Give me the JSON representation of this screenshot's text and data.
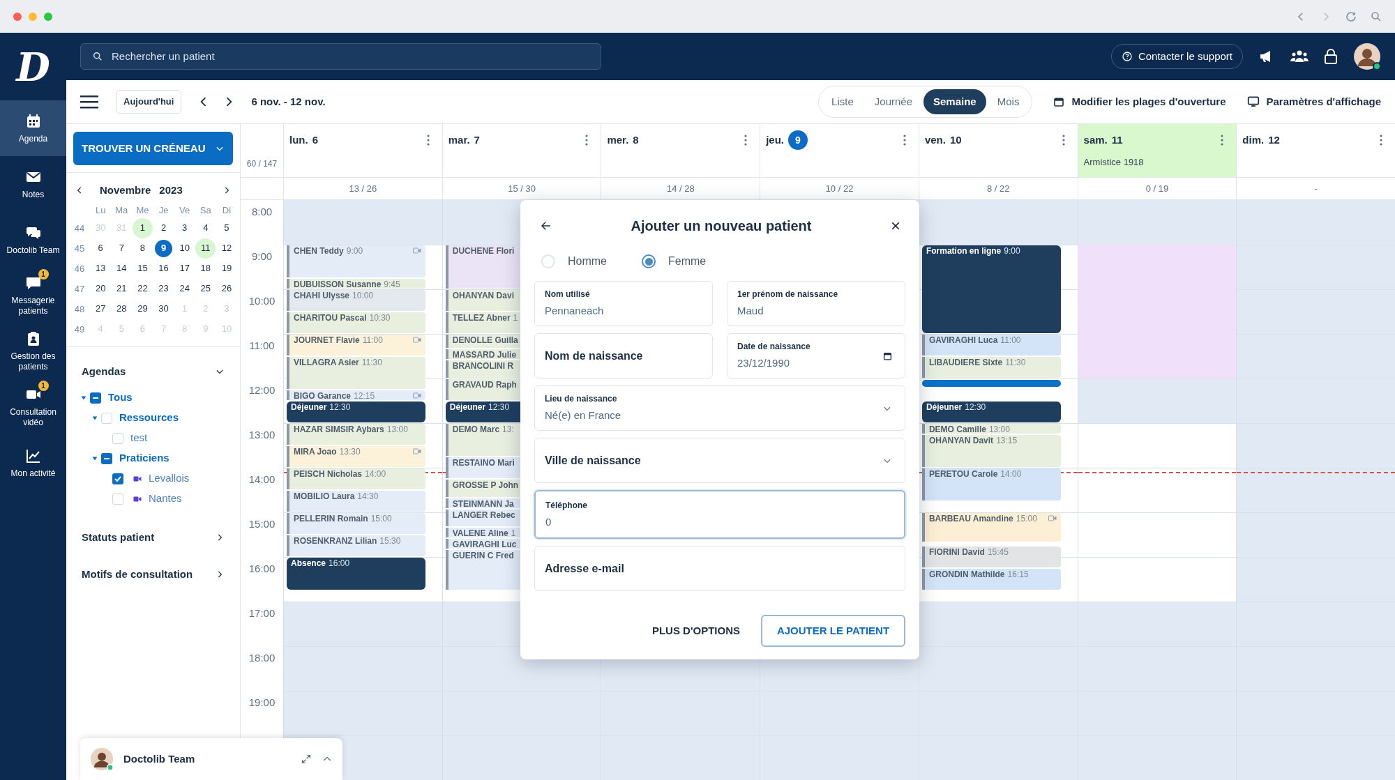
{
  "nav": {
    "logo": "D",
    "items": [
      {
        "label": "Agenda",
        "selected": true
      },
      {
        "label": "Notes",
        "selected": false
      },
      {
        "label": "Doctolib Team",
        "selected": false
      },
      {
        "label": "Messagerie patients",
        "selected": false,
        "badge": "1"
      },
      {
        "label": "Gestion des patients",
        "selected": false
      },
      {
        "label": "Consultation vidéo",
        "selected": false,
        "badge": "1"
      },
      {
        "label": "Mon activité",
        "selected": false
      }
    ]
  },
  "search": {
    "placeholder": "Rechercher un patient"
  },
  "support_button": "Contacter le support",
  "toolbar": {
    "today": "Aujourd'hui",
    "range": "6 nov. - 12 nov.",
    "views": [
      {
        "label": "Liste",
        "selected": false
      },
      {
        "label": "Journée",
        "selected": false
      },
      {
        "label": "Semaine",
        "selected": true
      },
      {
        "label": "Mois",
        "selected": false
      }
    ],
    "actions": [
      "Modifier les plages d'ouverture",
      "Paramètres d'affichage"
    ]
  },
  "find_slot": "TROUVER UN CRÉNEAU",
  "mini_calendar": {
    "month": "Novembre",
    "year": "2023",
    "weekdays": [
      "Lu",
      "Ma",
      "Me",
      "Je",
      "Ve",
      "Sa",
      "Di"
    ],
    "weeks": [
      {
        "number": "44",
        "days": [
          {
            "label": "30",
            "outside": true,
            "marked": false,
            "selected": false
          },
          {
            "label": "31",
            "outside": true,
            "marked": false,
            "selected": false
          },
          {
            "label": "1",
            "outside": false,
            "marked": true,
            "selected": false
          },
          {
            "label": "2",
            "outside": false,
            "marked": false,
            "selected": false
          },
          {
            "label": "3",
            "outside": false,
            "marked": false,
            "selected": false
          },
          {
            "label": "4",
            "outside": false,
            "marked": false,
            "selected": false
          },
          {
            "label": "5",
            "outside": false,
            "marked": false,
            "selected": false
          }
        ]
      },
      {
        "number": "45",
        "days": [
          {
            "label": "6",
            "outside": false,
            "marked": false,
            "selected": false
          },
          {
            "label": "7",
            "outside": false,
            "marked": false,
            "selected": false
          },
          {
            "label": "8",
            "outside": false,
            "marked": false,
            "selected": false
          },
          {
            "label": "9",
            "outside": false,
            "marked": false,
            "selected": true
          },
          {
            "label": "10",
            "outside": false,
            "marked": false,
            "selected": false
          },
          {
            "label": "11",
            "outside": false,
            "marked": true,
            "selected": false
          },
          {
            "label": "12",
            "outside": false,
            "marked": false,
            "selected": false
          }
        ]
      },
      {
        "number": "46",
        "days": [
          {
            "label": "13",
            "outside": false,
            "marked": false,
            "selected": false
          },
          {
            "label": "14",
            "outside": false,
            "marked": false,
            "selected": false
          },
          {
            "label": "15",
            "outside": false,
            "marked": false,
            "selected": false
          },
          {
            "label": "16",
            "outside": false,
            "marked": false,
            "selected": false
          },
          {
            "label": "17",
            "outside": false,
            "marked": false,
            "selected": false
          },
          {
            "label": "18",
            "outside": false,
            "marked": false,
            "selected": false
          },
          {
            "label": "19",
            "outside": false,
            "marked": false,
            "selected": false
          }
        ]
      },
      {
        "number": "47",
        "days": [
          {
            "label": "20",
            "outside": false,
            "marked": false,
            "selected": false
          },
          {
            "label": "21",
            "outside": false,
            "marked": false,
            "selected": false
          },
          {
            "label": "22",
            "outside": false,
            "marked": false,
            "selected": false
          },
          {
            "label": "23",
            "outside": false,
            "marked": false,
            "selected": false
          },
          {
            "label": "24",
            "outside": false,
            "marked": false,
            "selected": false
          },
          {
            "label": "25",
            "outside": false,
            "marked": false,
            "selected": false
          },
          {
            "label": "26",
            "outside": false,
            "marked": false,
            "selected": false
          }
        ]
      },
      {
        "number": "48",
        "days": [
          {
            "label": "27",
            "outside": false,
            "marked": false,
            "selected": false
          },
          {
            "label": "28",
            "outside": false,
            "marked": false,
            "selected": false
          },
          {
            "label": "29",
            "outside": false,
            "marked": false,
            "selected": false
          },
          {
            "label": "30",
            "outside": false,
            "marked": false,
            "selected": false
          },
          {
            "label": "1",
            "outside": true,
            "marked": false,
            "selected": false
          },
          {
            "label": "2",
            "outside": true,
            "marked": false,
            "selected": false
          },
          {
            "label": "3",
            "outside": true,
            "marked": false,
            "selected": false
          }
        ]
      },
      {
        "number": "49",
        "days": [
          {
            "label": "4",
            "outside": true,
            "marked": false,
            "selected": false
          },
          {
            "label": "5",
            "outside": true,
            "marked": false,
            "selected": false
          },
          {
            "label": "6",
            "outside": true,
            "marked": false,
            "selected": false
          },
          {
            "label": "7",
            "outside": true,
            "marked": false,
            "selected": false
          },
          {
            "label": "8",
            "outside": true,
            "marked": false,
            "selected": false
          },
          {
            "label": "9",
            "outside": true,
            "marked": false,
            "selected": false
          },
          {
            "label": "10",
            "outside": true,
            "marked": false,
            "selected": false
          }
        ]
      }
    ]
  },
  "agendas": {
    "title": "Agendas",
    "expanded": true,
    "tree": [
      {
        "label": "Tous",
        "checked": true,
        "indeterminate": true,
        "expanded": true,
        "children": [
          {
            "label": "Ressources",
            "checked": false,
            "indeterminate": false,
            "expanded": true,
            "children": [
              {
                "label": "test",
                "checked": false,
                "indeterminate": false
              }
            ]
          },
          {
            "label": "Praticiens",
            "checked": true,
            "indeterminate": true,
            "expanded": true,
            "children": [
              {
                "label": "Levallois",
                "checked": true,
                "indeterminate": false,
                "video": true
              },
              {
                "label": "Nantes",
                "checked": false,
                "indeterminate": false,
                "video": true
              }
            ]
          }
        ]
      }
    ]
  },
  "sections": [
    {
      "label": "Statuts patient",
      "expanded": false
    },
    {
      "label": "Motifs de consultation",
      "expanded": false
    }
  ],
  "week": {
    "total": "60 / 147",
    "hours": [
      "8:00",
      "9:00",
      "10:00",
      "11:00",
      "12:00",
      "13:00",
      "14:00",
      "15:00",
      "16:00",
      "17:00",
      "18:00",
      "19:00"
    ],
    "days": [
      {
        "weekday": "lun.",
        "day": "6",
        "count": "13 / 26",
        "today": false,
        "holiday": false,
        "events": [
          {
            "kind": "appointment",
            "name": "CHEN Teddy",
            "time": "9:00",
            "color": "#e3ecf7",
            "video": true
          },
          {
            "kind": "appointment",
            "name": "DUBUISSON Susanne",
            "time": "9:45",
            "color": "#e8efdf",
            "video": false
          },
          {
            "kind": "appointment",
            "name": "CHAHI Ulysse",
            "time": "10:00",
            "color": "#e4e9ef",
            "video": false
          },
          {
            "kind": "appointment",
            "name": "CHARITOU Pascal",
            "time": "10:30",
            "color": "#e8efdf",
            "video": false
          },
          {
            "kind": "appointment",
            "name": "JOURNET Flavie",
            "time": "11:00",
            "color": "#fcf2da",
            "video": true
          },
          {
            "kind": "appointment",
            "name": "VILLAGRA Asier",
            "time": "11:30",
            "color": "#e8efdf",
            "video": false
          },
          {
            "kind": "appointment",
            "name": "BIGO Garance",
            "time": "12:15",
            "color": "#e3ecf7",
            "video": true
          },
          {
            "kind": "break",
            "name": "Déjeuner",
            "time": "12:30",
            "color": "#1f3e5e"
          },
          {
            "kind": "appointment",
            "name": "HAZAR SIMSIR Aybars",
            "time": "13:00",
            "color": "#e8efdf",
            "video": false
          },
          {
            "kind": "appointment",
            "name": "MIRA Joao",
            "time": "13:30",
            "color": "#fcf2da",
            "video": true
          },
          {
            "kind": "appointment",
            "name": "PEISCH Nicholas",
            "time": "14:00",
            "color": "#e8efdf",
            "video": false
          },
          {
            "kind": "appointment",
            "name": "MOBILIO Laura",
            "time": "14:30",
            "color": "#e3ecf7",
            "video": false
          },
          {
            "kind": "appointment",
            "name": "PELLERIN Romain",
            "time": "15:00",
            "color": "#e3ecf7",
            "video": false
          },
          {
            "kind": "appointment",
            "name": "ROSENKRANZ Lilian",
            "time": "15:30",
            "color": "#e3ecf7",
            "video": false
          },
          {
            "kind": "break",
            "name": "Absence",
            "time": "16:00",
            "color": "#1f3e5e"
          }
        ]
      },
      {
        "weekday": "mar.",
        "day": "7",
        "count": "15 / 30",
        "today": false,
        "holiday": false,
        "events": [
          {
            "kind": "appointment",
            "name": "DUCHENE Flori",
            "color": "#ebe4f6",
            "video": false
          },
          {
            "kind": "appointment",
            "name": "OHANYAN Davi",
            "color": "#e8efdf",
            "video": false
          },
          {
            "kind": "appointment",
            "name": "TELLEZ Abner",
            "time": "1",
            "color": "#e8efdf",
            "video": false
          },
          {
            "kind": "appointment",
            "name": "DENOLLE Guilla",
            "color": "#e8efdf",
            "video": false
          },
          {
            "kind": "appointment",
            "name": "MASSARD Julie",
            "color": "#e8efdf",
            "video": false
          },
          {
            "kind": "appointment",
            "name": "BRANCOLINI R",
            "color": "#e8efdf",
            "video": false
          },
          {
            "kind": "appointment",
            "name": "GRAVAUD Raph",
            "color": "#e8efdf",
            "video": false
          },
          {
            "kind": "break",
            "name": "Déjeuner",
            "time": "12:30",
            "color": "#1f3e5e"
          },
          {
            "kind": "appointment",
            "name": "DEMO Marc",
            "time": "13:",
            "color": "#e8efdf",
            "video": false
          },
          {
            "kind": "appointment",
            "name": "RESTAINO Mari",
            "color": "#e3ecf7",
            "video": false
          },
          {
            "kind": "appointment",
            "name": "GROSSE P John",
            "color": "#e8efdf",
            "video": false
          },
          {
            "kind": "appointment",
            "name": "STEINMANN Ja",
            "color": "#e3ecf7",
            "video": false
          },
          {
            "kind": "appointment",
            "name": "LANGER Rebec",
            "color": "#e3ecf7",
            "video": false
          },
          {
            "kind": "appointment",
            "name": "VALENE Aline",
            "time": "1",
            "color": "#e3ecf7",
            "video": false
          },
          {
            "kind": "appointment",
            "name": "GAVIRAGHI Luc",
            "color": "#e3ecf7",
            "video": false
          },
          {
            "kind": "appointment",
            "name": "GUERIN C Fred",
            "color": "#e3ecf7",
            "video": false
          }
        ]
      },
      {
        "weekday": "mer.",
        "day": "8",
        "count": "14 / 28",
        "today": false,
        "holiday": false
      },
      {
        "weekday": "jeu.",
        "day": "9",
        "count": "10 / 22",
        "today": true,
        "holiday": false
      },
      {
        "weekday": "ven.",
        "day": "10",
        "count": "8 / 22",
        "today": false,
        "holiday": false,
        "events": [
          {
            "kind": "break",
            "name": "Formation en ligne",
            "time": "9:00",
            "color": "#1f3e5e"
          },
          {
            "kind": "appointment",
            "name": "GAVIRAGHI Luca",
            "time": "11:00",
            "color": "#d3e4f8",
            "video": false
          },
          {
            "kind": "appointment",
            "name": "LIBAUDIERE Sixte",
            "time": "11:30",
            "color": "#e8efdf",
            "video": false
          },
          {
            "kind": "marker",
            "color": "#0b72c6"
          },
          {
            "kind": "break",
            "name": "Déjeuner",
            "time": "12:30",
            "color": "#1f3e5e"
          },
          {
            "kind": "appointment",
            "name": "DEMO Camille",
            "time": "13:00",
            "color": "#e8efdf",
            "video": false
          },
          {
            "kind": "appointment",
            "name": "OHANYAN Davit",
            "time": "13:15",
            "color": "#e8efdf",
            "video": false
          },
          {
            "kind": "appointment",
            "name": "PERETOU Carole",
            "time": "14:00",
            "color": "#d3e4f8",
            "video": false
          },
          {
            "kind": "appointment",
            "name": "BARBEAU Amandine",
            "time": "15:00",
            "color": "#fdefd3",
            "video": true
          },
          {
            "kind": "appointment",
            "name": "FIORINI David",
            "time": "15:45",
            "color": "#e3e4e6",
            "video": false
          },
          {
            "kind": "appointment",
            "name": "GRONDIN Mathilde",
            "time": "16:15",
            "color": "#d3e4f8",
            "video": false
          }
        ]
      },
      {
        "weekday": "sam.",
        "day": "11",
        "count": "0 / 19",
        "today": false,
        "holiday": true,
        "note": "Armistice 1918",
        "events": [
          {
            "kind": "block",
            "color": "#f0e0fa"
          }
        ]
      },
      {
        "weekday": "dim.",
        "day": "12",
        "count": "-",
        "today": false,
        "holiday": false
      }
    ]
  },
  "modal": {
    "title": "Ajouter un nouveau patient",
    "gender": [
      {
        "label": "Homme",
        "selected": false
      },
      {
        "label": "Femme",
        "selected": true
      }
    ],
    "field_rows": [
      [
        {
          "kind": "text",
          "label": "Nom utilisé",
          "value": "Pennaneach",
          "focused": false
        },
        {
          "kind": "text",
          "label": "1er prénom de naissance",
          "value": "Maud",
          "focused": false
        }
      ],
      [
        {
          "kind": "text",
          "label": "Nom de naissance",
          "focused": false
        },
        {
          "kind": "date",
          "label": "Date de naissance",
          "value": "23/12/1990",
          "focused": false
        }
      ],
      [
        {
          "kind": "select",
          "label": "Lieu de naissance",
          "value": "Né(e) en France",
          "focused": false
        }
      ],
      [
        {
          "kind": "select",
          "label": "Ville de naissance",
          "focused": false
        }
      ],
      [
        {
          "kind": "text",
          "label": "Téléphone",
          "value": "0",
          "focused": true
        }
      ],
      [
        {
          "kind": "text",
          "label": "Adresse e-mail",
          "focused": false
        }
      ]
    ],
    "secondary_button": "PLUS D'OPTIONS",
    "primary_button": "AJOUTER LE PATIENT"
  },
  "chat": {
    "label": "Doctolib Team"
  }
}
